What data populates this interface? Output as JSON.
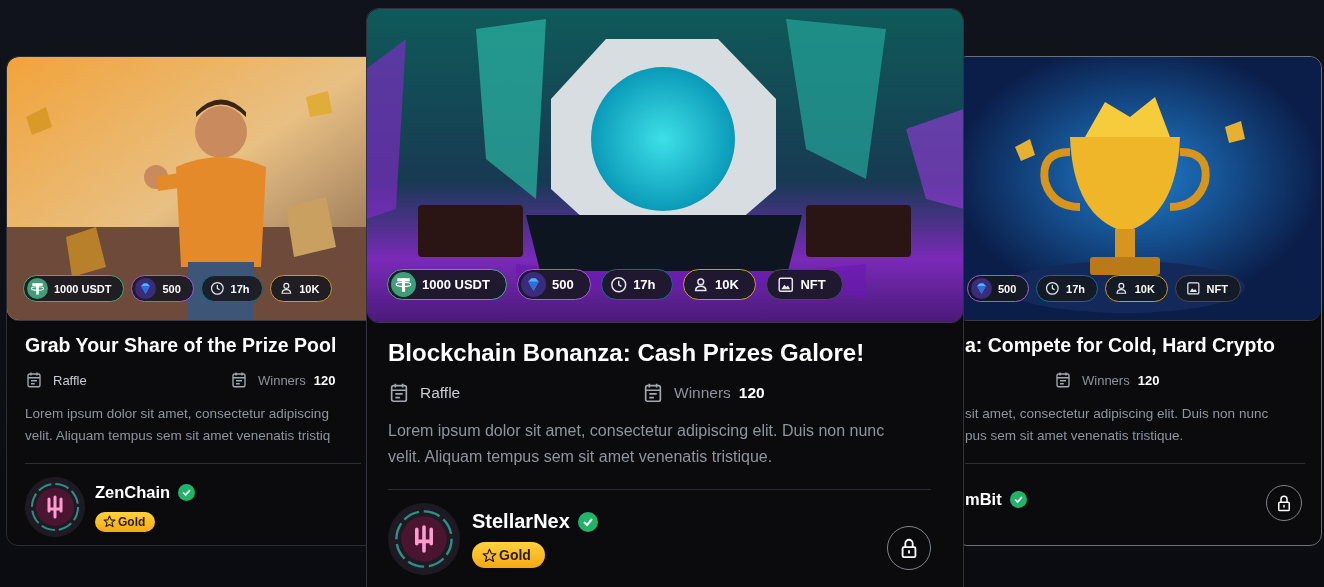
{
  "cards": [
    {
      "kind": "side",
      "chips": [
        {
          "kind": "usdt",
          "label": "1000 USDT"
        },
        {
          "kind": "gems",
          "label": "500"
        },
        {
          "kind": "time",
          "label": "17h"
        },
        {
          "kind": "participants",
          "label": "10K"
        }
      ],
      "title": "Grab Your Share of the Prize Pool",
      "type": "Raffle",
      "winners_label": "Winners",
      "winners_value": "120",
      "description": "Lorem ipsum dolor sit amet, consectetur adipiscing\nvelit. Aliquam tempus sem sit amet venenatis tristiq",
      "creator": {
        "name": "ZenChain",
        "verified": true,
        "tier": "Gold"
      },
      "locked": false
    },
    {
      "kind": "featured",
      "chips": [
        {
          "kind": "usdt",
          "label": "1000 USDT"
        },
        {
          "kind": "gems",
          "label": "500"
        },
        {
          "kind": "time",
          "label": "17h"
        },
        {
          "kind": "participants",
          "label": "10K"
        },
        {
          "kind": "nft",
          "label": "NFT"
        }
      ],
      "title": "Blockchain Bonanza: Cash Prizes Galore!",
      "type": "Raffle",
      "winners_label": "Winners",
      "winners_value": "120",
      "description": "Lorem ipsum dolor sit amet, consectetur adipiscing elit. Duis non nunc\nvelit. Aliquam tempus sem sit amet venenatis tristique.",
      "creator": {
        "name": "StellarNex",
        "verified": true,
        "tier": "Gold"
      },
      "locked": true
    },
    {
      "kind": "side",
      "chips": [
        {
          "kind": "gems",
          "label": "500"
        },
        {
          "kind": "time",
          "label": "17h"
        },
        {
          "kind": "participants",
          "label": "10K"
        },
        {
          "kind": "nft",
          "label": "NFT"
        }
      ],
      "title": "a: Compete for Cold, Hard Crypto",
      "winners_label": "Winners",
      "winners_value": "120",
      "description": "sit amet, consectetur adipiscing elit. Duis non nunc\npus sem sit amet venenatis tristique.",
      "creator": {
        "name": "mBit",
        "verified": true
      },
      "locked": true
    }
  ]
}
